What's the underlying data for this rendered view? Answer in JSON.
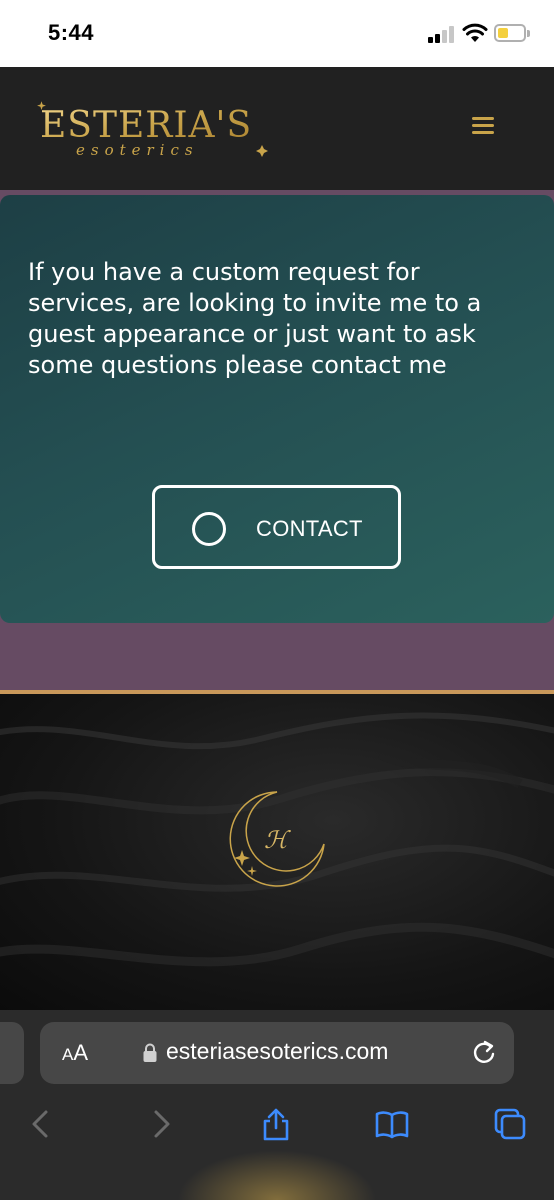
{
  "status_bar": {
    "time": "5:44",
    "battery_level": 0.4,
    "colors": {
      "battery": "#f4d03f"
    }
  },
  "site_header": {
    "logo_text": "ESTERIA'S",
    "logo_subtext": "esoterics",
    "colors": {
      "gold": "#c9a44a",
      "background": "#212121"
    }
  },
  "contact_card": {
    "message": "If you have a custom request for services, are looking to invite me to a guest appearance or just want to ask some questions please contact me",
    "button_label": "CONTACT",
    "colors": {
      "card": "#244f52",
      "section": "#664b63"
    }
  },
  "footer": {
    "monogram": "ℋ",
    "colors": {
      "divider": "#c9985a",
      "gold": "#c9a44a"
    }
  },
  "browser": {
    "aa_label_big": "A",
    "aa_label_small": "A",
    "url": "esteriasesoterics.com",
    "toolbar_icons": [
      "back-icon",
      "forward-icon",
      "share-icon",
      "bookmarks-icon",
      "tabs-icon"
    ],
    "colors": {
      "accent": "#3d8bfd"
    }
  }
}
